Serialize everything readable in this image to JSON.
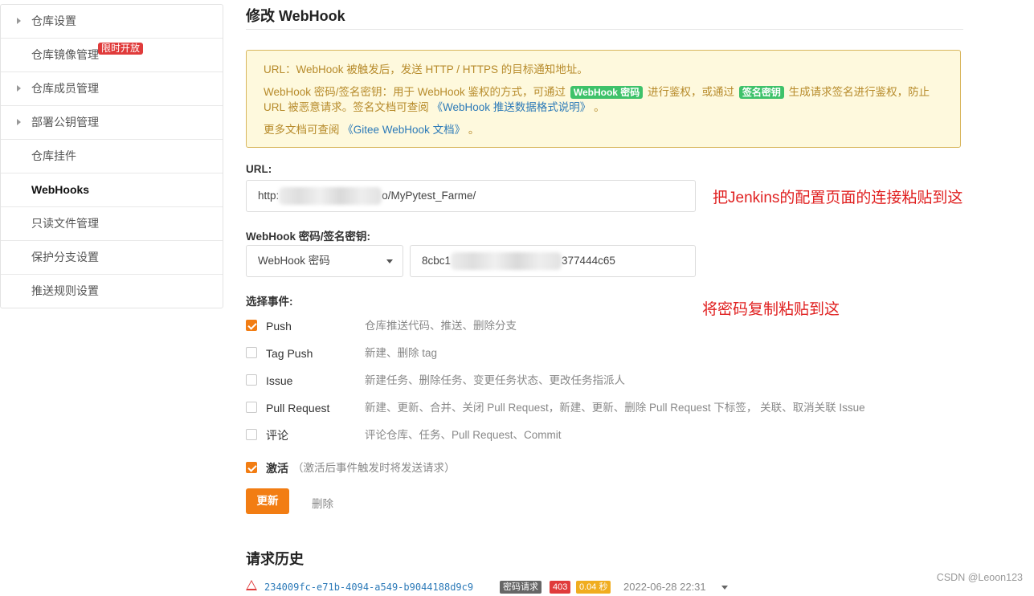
{
  "sidebar": {
    "items": [
      {
        "label": "仓库设置",
        "expandable": true,
        "active": false
      },
      {
        "label": "仓库镜像管理",
        "expandable": false,
        "active": false,
        "badge": "限时开放"
      },
      {
        "label": "仓库成员管理",
        "expandable": true,
        "active": false
      },
      {
        "label": "部署公钥管理",
        "expandable": true,
        "active": false
      },
      {
        "label": "仓库挂件",
        "expandable": false,
        "active": false
      },
      {
        "label": "WebHooks",
        "expandable": false,
        "active": true
      },
      {
        "label": "只读文件管理",
        "expandable": false,
        "active": false
      },
      {
        "label": "保护分支设置",
        "expandable": false,
        "active": false
      },
      {
        "label": "推送规则设置",
        "expandable": false,
        "active": false
      }
    ]
  },
  "page": {
    "title": "修改 WebHook"
  },
  "notice": {
    "url_line": "URL：WebHook 被触发后，发送 HTTP / HTTPS 的目标通知地址。",
    "secret_prefix": "WebHook 密码/签名密钥：用于 WebHook 鉴权的方式，可通过",
    "tag_password": "WebHook 密码",
    "secret_mid": "进行鉴权，或通过",
    "tag_sign": "签名密钥",
    "secret_suffix": "生成请求签名进行鉴权，防止 URL 被恶意请求。签名文档可查阅",
    "doc_link_1": "《WebHook 推送数据格式说明》",
    "period": "。",
    "more_prefix": "更多文档可查阅",
    "doc_link_2": "《Gitee WebHook 文档》",
    "more_suffix": "。"
  },
  "form": {
    "url_label": "URL:",
    "url_value_start": "http:",
    "url_value_end": "o/MyPytest_Farme/",
    "secret_label": "WebHook 密码/签名密钥:",
    "secret_type": "WebHook 密码",
    "secret_value_start": "8cbc1",
    "secret_value_end": "377444c65",
    "events_label": "选择事件:",
    "events": [
      {
        "name": "Push",
        "desc": "仓库推送代码、推送、删除分支",
        "checked": true
      },
      {
        "name": "Tag Push",
        "desc": "新建、删除 tag",
        "checked": false
      },
      {
        "name": "Issue",
        "desc": "新建任务、删除任务、变更任务状态、更改任务指派人",
        "checked": false
      },
      {
        "name": "Pull Request",
        "desc": "新建、更新、合并、关闭 Pull Request，新建、更新、删除 Pull Request 下标签，  关联、取消关联 Issue",
        "checked": false
      },
      {
        "name": "评论",
        "desc": "评论仓库、任务、Pull Request、Commit",
        "checked": false
      }
    ],
    "activate_label": "激活",
    "activate_hint": "（激活后事件触发时将发送请求）",
    "activate_checked": true,
    "update_button": "更新",
    "delete_button": "删除"
  },
  "history": {
    "title": "请求历史",
    "rows": [
      {
        "id": "234009fc-e71b-4094-a549-b9044188d9c9",
        "type_chip": "密码请求",
        "status": "403",
        "duration": "0.04 秒",
        "time": "2022-06-28 22:31"
      }
    ]
  },
  "annotations": {
    "url_note": "把Jenkins的配置页面的连接粘贴到这",
    "secret_note": "将密码复制粘贴到这"
  },
  "watermark": "CSDN @Leoon123",
  "colors": {
    "accent": "#f27d13",
    "notice_bg": "#fef9dd",
    "notice_text": "#b78b2b",
    "tag_green": "#3ec26a",
    "error_red": "#e03b3b",
    "link": "#2c7ab8"
  }
}
